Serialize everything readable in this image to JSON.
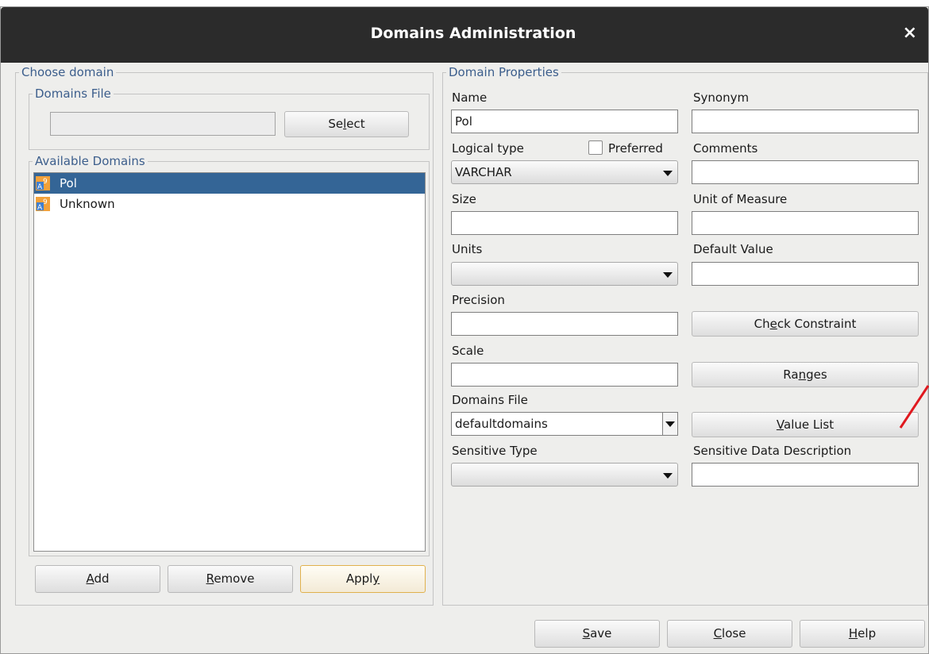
{
  "window": {
    "title": "Domains Administration",
    "close_glyph": "×"
  },
  "choose_domain": {
    "legend": "Choose domain",
    "domains_file": {
      "legend": "Domains File",
      "value": "",
      "select_button": [
        "Se",
        "l",
        "ect"
      ]
    },
    "available_domains": {
      "legend": "Available Domains",
      "items": [
        {
          "label": "Pol",
          "selected": true,
          "icon": "domain-icon"
        },
        {
          "label": "Unknown",
          "selected": false,
          "icon": "domain-icon"
        }
      ]
    },
    "buttons": {
      "add": [
        "",
        "A",
        "dd"
      ],
      "remove": [
        "",
        "R",
        "emove"
      ],
      "apply": [
        "Appl",
        "y",
        ""
      ]
    }
  },
  "properties": {
    "legend": "Domain Properties",
    "name_label": "Name",
    "name_value": "Pol",
    "synonym_label": "Synonym",
    "synonym_value": "",
    "logical_type_label": "Logical type",
    "logical_type_value": "VARCHAR",
    "preferred_label": "Preferred",
    "preferred_checked": false,
    "comments_label": "Comments",
    "comments_value": "",
    "size_label": "Size",
    "size_value": "",
    "unit_of_measure_label": "Unit of Measure",
    "unit_of_measure_value": "",
    "units_label": "Units",
    "units_value": "",
    "default_value_label": "Default Value",
    "default_value_value": "",
    "precision_label": "Precision",
    "precision_value": "",
    "check_constraint_button": [
      "Ch",
      "e",
      "ck Constraint"
    ],
    "scale_label": "Scale",
    "scale_value": "",
    "ranges_button": [
      "Ra",
      "n",
      "ges"
    ],
    "domains_file_label": "Domains File",
    "domains_file_value": "defaultdomains",
    "value_list_button": [
      "",
      "V",
      "alue List"
    ],
    "sensitive_type_label": "Sensitive Type",
    "sensitive_type_value": "",
    "sensitive_data_description_label": "Sensitive Data Description",
    "sensitive_data_description_value": ""
  },
  "footer": {
    "save": [
      "",
      "S",
      "ave"
    ],
    "close": [
      "",
      "C",
      "lose"
    ],
    "help": [
      "",
      "H",
      "elp"
    ]
  },
  "colors": {
    "accent": "#346596",
    "legend": "#3c5e8c",
    "titlebar": "#2b2b2b",
    "annotation": "#e0191f"
  }
}
